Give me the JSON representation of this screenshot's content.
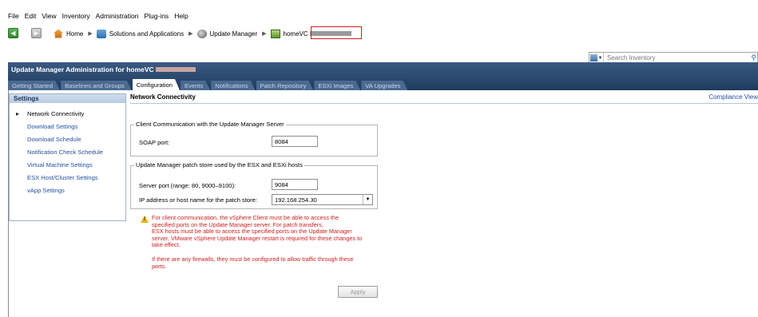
{
  "menu": [
    "File",
    "Edit",
    "View",
    "Inventory",
    "Administration",
    "Plug-ins",
    "Help"
  ],
  "nav": {
    "back_glyph": "◀",
    "forward_glyph": "▶",
    "breadcrumbs": [
      "Home",
      "Solutions and Applications",
      "Update Manager",
      "homeVC"
    ]
  },
  "search": {
    "placeholder": "Search Inventory"
  },
  "admin": {
    "title": "Update Manager Administration for homeVC",
    "tabs": [
      "Getting Started",
      "Baselines and Groups",
      "Configuration",
      "Events",
      "Notifications",
      "Patch Repository",
      "ESXi Images",
      "VA Upgrades"
    ],
    "active_tab": "Configuration"
  },
  "settings": {
    "heading": "Settings",
    "items": [
      "Network Connectivity",
      "Download Settings",
      "Download Schedule",
      "Notification Check Schedule",
      "Virtual Machine Settings",
      "ESX Host/Cluster Settings",
      "vApp Settings"
    ]
  },
  "main": {
    "title": "Network Connectivity",
    "compliance_link": "Compliance View",
    "client_group": {
      "legend": "Client Communication with the Update Manager Server",
      "soap_label": "SOAP port:",
      "soap_value": "8084"
    },
    "patch_group": {
      "legend": "Update Manager patch store used by the ESX and ESXi hosts",
      "server_port_label": "Server port (range: 80, 9000–9100):",
      "server_port_value": "9084",
      "ip_label": "IP address or host name for the patch store:",
      "ip_value": "192.168.254.30"
    },
    "warning": {
      "para1_l1": "For client communication, the vSphere Client must be able to access the",
      "para1_l2": "specified ports on the Update Manager server. For patch transfers,",
      "para1_l3": "ESX hosts must be able to access the specified ports on the Update Manager",
      "para1_l4": "server. VMware vSphere Update Manager restart is required for these changes to",
      "para1_l5": "take effect.",
      "para2_l1": "If there are any firewalls, they must be configured to allow traffic through these",
      "para2_l2": "ports."
    },
    "apply_label": "Apply"
  }
}
